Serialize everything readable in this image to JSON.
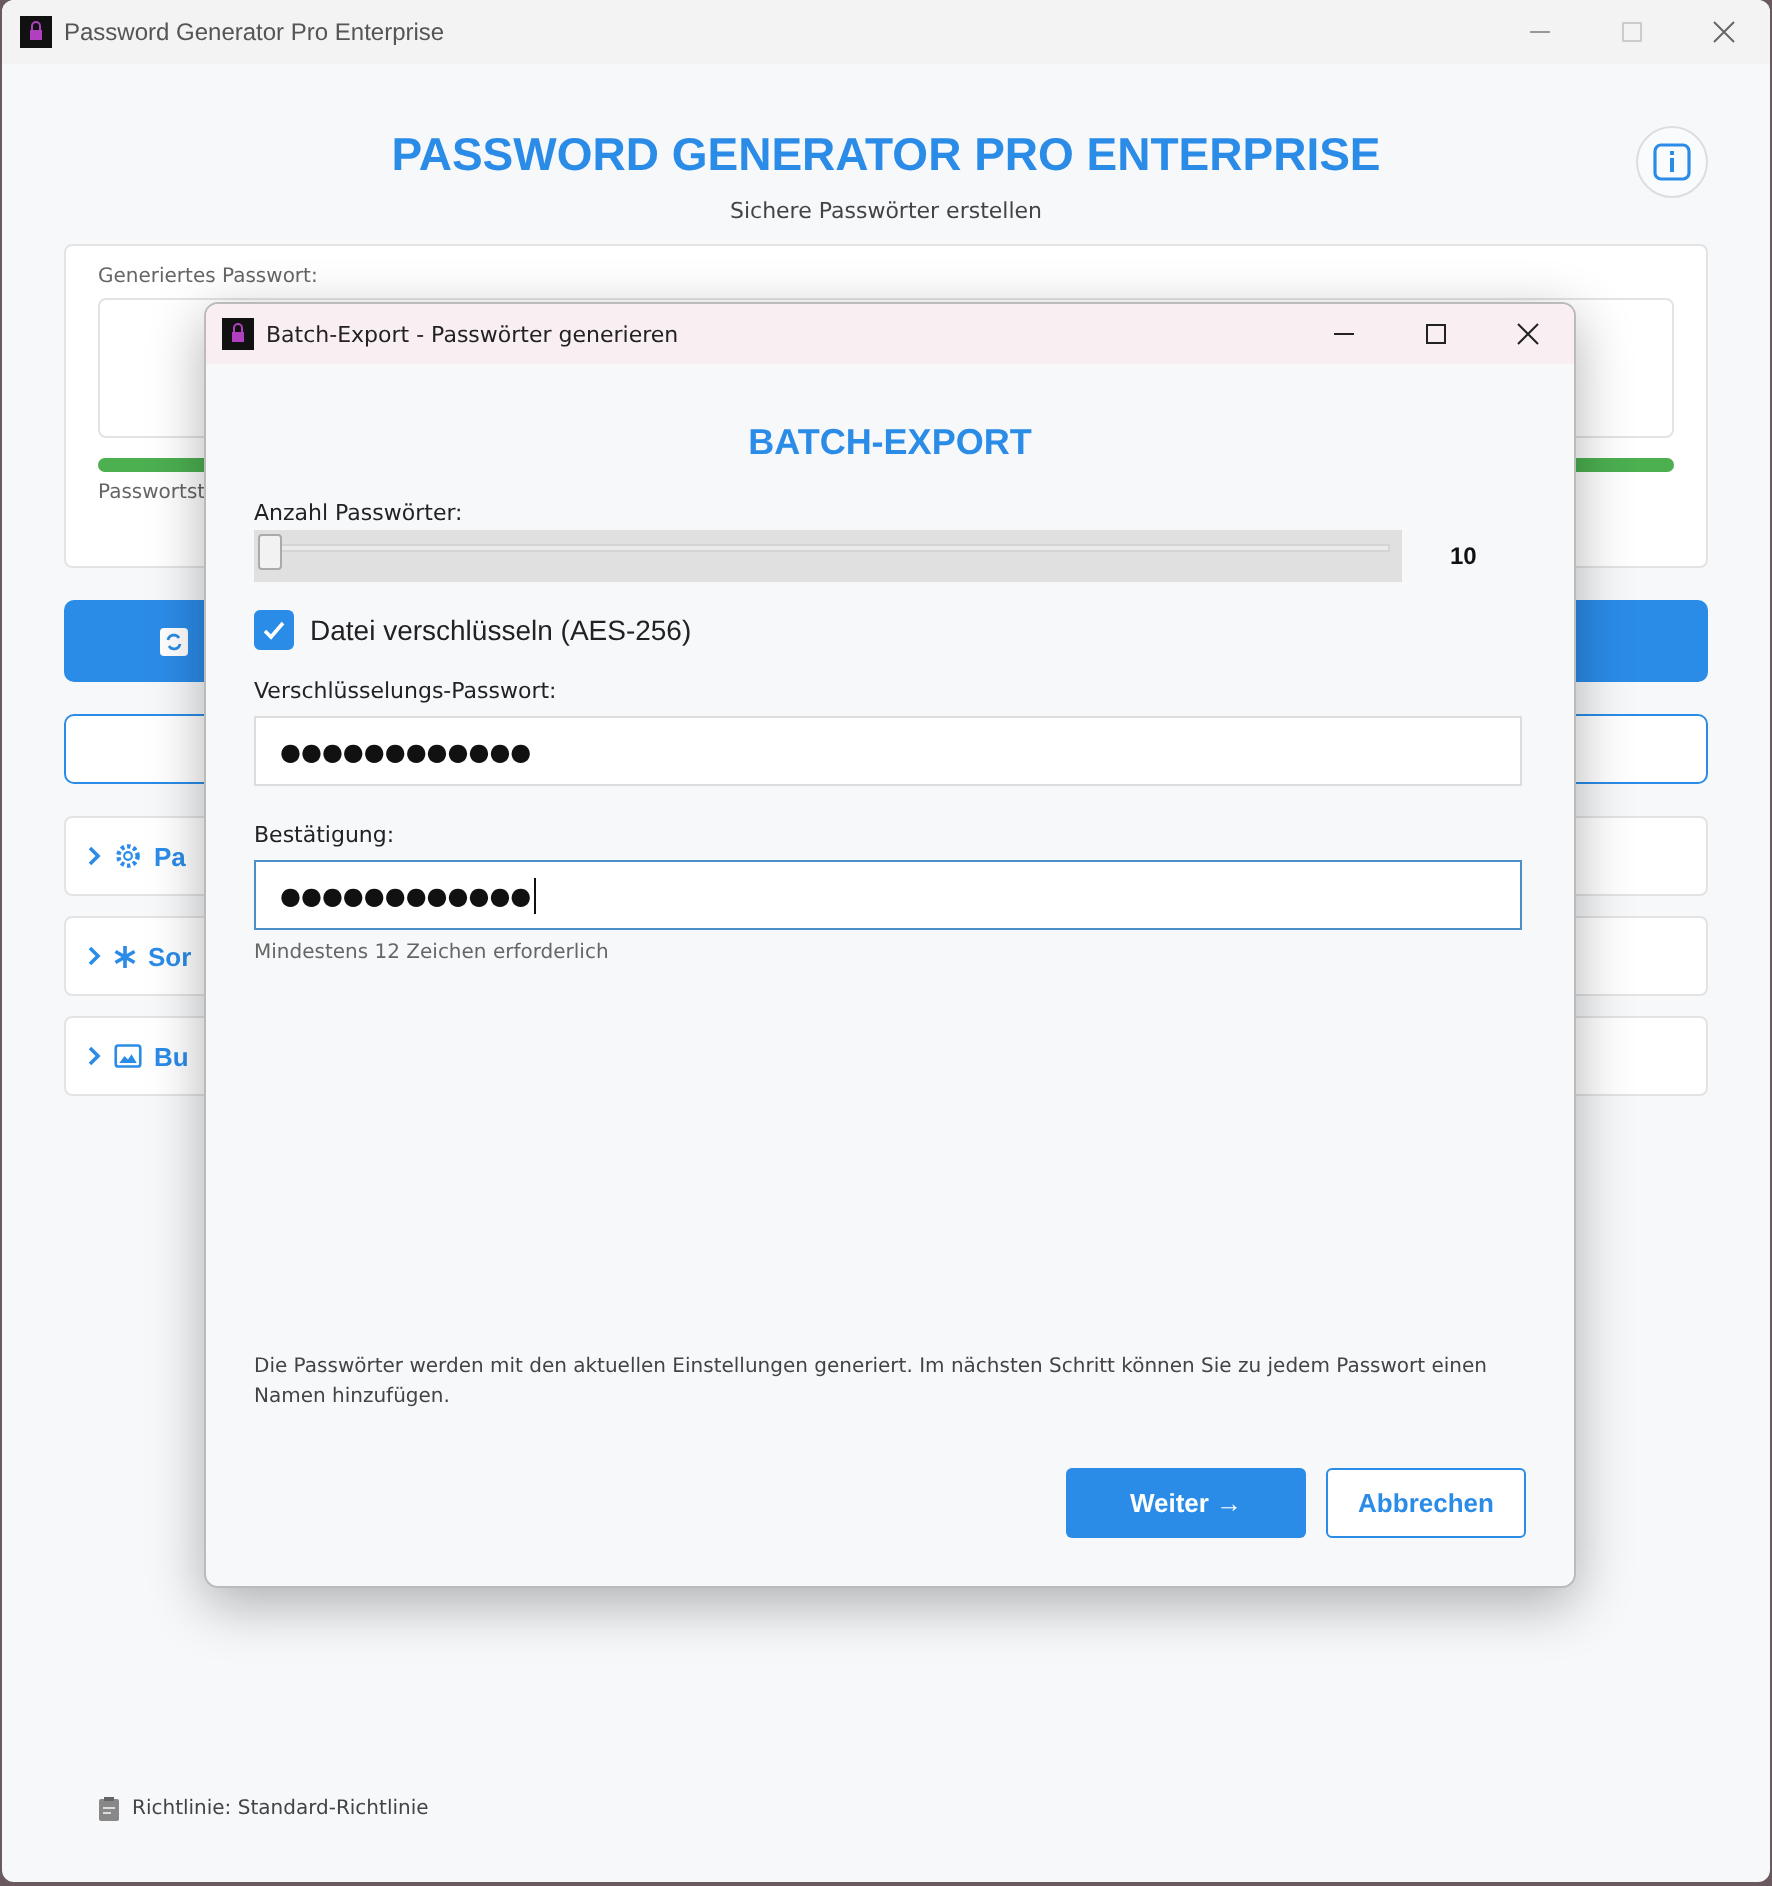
{
  "window": {
    "title": "Password Generator Pro Enterprise"
  },
  "header": {
    "title": "PASSWORD GENERATOR PRO ENTERPRISE",
    "subtitle": "Sichere Passwörter erstellen"
  },
  "password_card": {
    "label": "Generiertes Passwort:",
    "strength_label": "Passwortst"
  },
  "sections": [
    {
      "label": "Pa"
    },
    {
      "label": "Sor"
    },
    {
      "label": "Bu"
    }
  ],
  "footer": {
    "text": "Richtlinie: Standard-Richtlinie"
  },
  "dialog": {
    "title": "Batch-Export - Passwörter generieren",
    "heading": "BATCH-EXPORT",
    "count_label": "Anzahl Passwörter:",
    "count": {
      "level": 0,
      "reading": "10"
    },
    "encrypt": {
      "label": "Datei verschlüsseln (AES-256)",
      "checked": true
    },
    "password_label": "Verschlüsselungs-Passwort:",
    "password_value": "●●●●●●●●●●●●",
    "confirm_label": "Bestätigung:",
    "confirm_value": "●●●●●●●●●●●●",
    "confirm_focused": true,
    "hint": "Mindestens 12 Zeichen erforderlich",
    "info": "Die Passwörter werden mit den aktuellen Einstellungen generiert. Im nächsten Schritt können Sie zu jedem Passwort einen Namen hinzufügen.",
    "buttons": [
      {
        "label": "Weiter →",
        "kind": "primary"
      },
      {
        "label": "Abbrechen",
        "kind": "secondary"
      }
    ]
  }
}
